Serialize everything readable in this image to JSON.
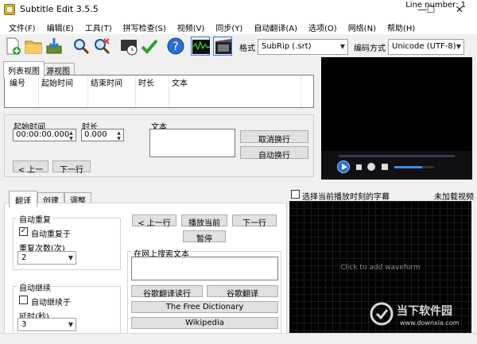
{
  "window": {
    "title": "Subtitle Edit 3.5.5",
    "minimize": "—",
    "maximize": "☐",
    "close": "✕"
  },
  "menu": [
    "文件(F)",
    "编辑(E)",
    "工具(T)",
    "拼写检查(S)",
    "视频(V)",
    "同步(Y)",
    "自动翻译(A)",
    "选项(O)",
    "网络(N)",
    "帮助(H)"
  ],
  "toolbar": {
    "format_label": "格式",
    "format_value": "SubRip (.srt)",
    "encoding_label": "编码方式",
    "encoding_value": "Unicode (UTF-8)"
  },
  "view_tabs": {
    "list": "列表视图",
    "source": "源视图"
  },
  "list": {
    "columns": [
      "编号",
      "起始时间",
      "结束时间",
      "时长",
      "文本"
    ]
  },
  "edit": {
    "start_label": "起始时间",
    "start_value": "00:00:00.000",
    "duration_label": "时长",
    "duration_value": "0.000",
    "text_label": "文本",
    "unbreak": "取消换行",
    "autobreak": "自动换行",
    "prev": "< 上一",
    "next": "下一行"
  },
  "video": {
    "show_current_label": "选择当前播放时刻的字幕",
    "no_video": "未加载视频"
  },
  "lower_tabs": {
    "translate": "翻译",
    "create": "创建",
    "adjust": "调整"
  },
  "translate": {
    "auto_repeat_group": "自动重复",
    "auto_repeat_on": "自动重复于",
    "repeat_count_label": "重复次数(次)",
    "repeat_count_value": "2",
    "auto_continue_group": "自动继续",
    "auto_continue_on": "自动继续于",
    "delay_label": "延时(秒)",
    "delay_value": "3",
    "prev_line": "< 上一行",
    "play_current": "播放当前",
    "next_line": "下一行",
    "pause": "暂停",
    "search_web_label": "在网上搜索文本",
    "google_it": "谷歌翻译读行",
    "google_translate": "谷歌翻译",
    "free_dictionary": "The Free Dictionary",
    "wikipedia": "Wikipedia"
  },
  "waveform": {
    "placeholder": "Click to add waveform"
  },
  "watermark": {
    "brand": "当下软件园",
    "url": "www.downxia.com"
  },
  "status": {
    "line_number": "Line number: 1"
  }
}
